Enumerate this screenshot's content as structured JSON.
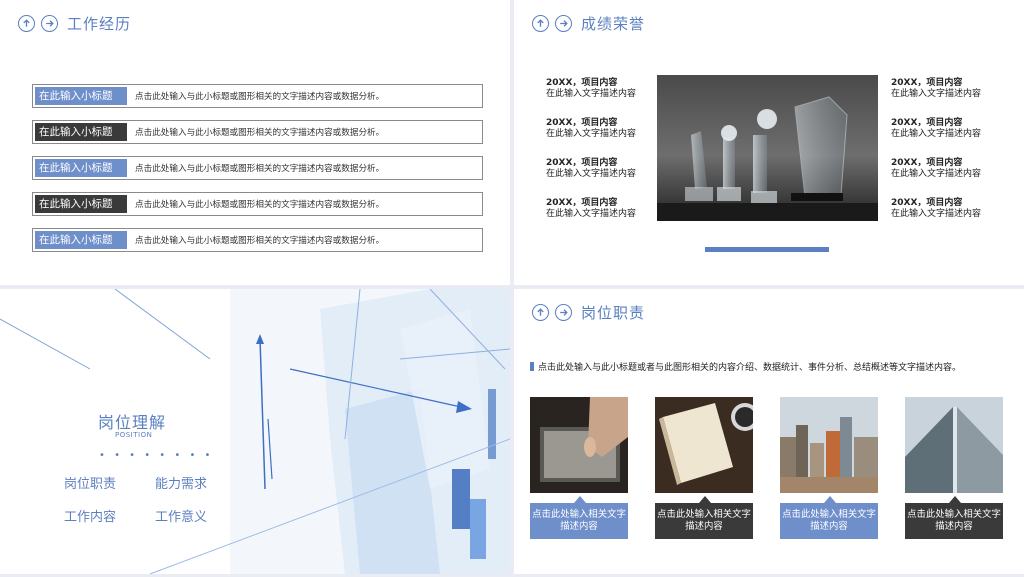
{
  "work": {
    "title": "工作经历",
    "rows": [
      {
        "tag": "在此输入小标题",
        "text": "点击此处输入与此小标题或图形相关的文字描述内容或数据分析。",
        "color": "#6f8fcb"
      },
      {
        "tag": "在此输入小标题",
        "text": "点击此处输入与此小标题或图形相关的文字描述内容或数据分析。",
        "color": "#3a3a3a"
      },
      {
        "tag": "在此输入小标题",
        "text": "点击此处输入与此小标题或图形相关的文字描述内容或数据分析。",
        "color": "#6f8fcb"
      },
      {
        "tag": "在此输入小标题",
        "text": "点击此处输入与此小标题或图形相关的文字描述内容或数据分析。",
        "color": "#3a3a3a"
      },
      {
        "tag": "在此输入小标题",
        "text": "点击此处输入与此小标题或图形相关的文字描述内容或数据分析。",
        "color": "#6f8fcb"
      }
    ]
  },
  "honors": {
    "title": "成绩荣誉",
    "left": [
      {
        "head": "20XX，项目内容",
        "desc": "在此输入文字描述内容"
      },
      {
        "head": "20XX，项目内容",
        "desc": "在此输入文字描述内容"
      },
      {
        "head": "20XX，项目内容",
        "desc": "在此输入文字描述内容"
      },
      {
        "head": "20XX，项目内容",
        "desc": "在此输入文字描述内容"
      }
    ],
    "right": [
      {
        "head": "20XX，项目内容",
        "desc": "在此输入文字描述内容"
      },
      {
        "head": "20XX，项目内容",
        "desc": "在此输入文字描述内容"
      },
      {
        "head": "20XX，项目内容",
        "desc": "在此输入文字描述内容"
      },
      {
        "head": "20XX，项目内容",
        "desc": "在此输入文字描述内容"
      }
    ]
  },
  "position": {
    "title": "岗位理解",
    "subtitle": "POSITION",
    "dots": "• • • • • • • •",
    "items": [
      "岗位职责",
      "能力需求",
      "工作内容",
      "工作意义"
    ]
  },
  "duties": {
    "title": "岗位职责",
    "intro": "点击此处输入与此小标题或者与此图形相关的内容介绍、数据统计、事件分析、总结概述等文字描述内容。",
    "cards": [
      {
        "caption": "点击此处输入相关文字描述内容",
        "color": "#6f8fcb"
      },
      {
        "caption": "点击此处输入相关文字描述内容",
        "color": "#3a3a3a"
      },
      {
        "caption": "点击此处输入相关文字描述内容",
        "color": "#6f8fcb"
      },
      {
        "caption": "点击此处输入相关文字描述内容",
        "color": "#3a3a3a"
      }
    ]
  },
  "colors": {
    "accent": "#5b7fc0",
    "dark": "#3a3a3a",
    "light": "#6f8fcb"
  }
}
